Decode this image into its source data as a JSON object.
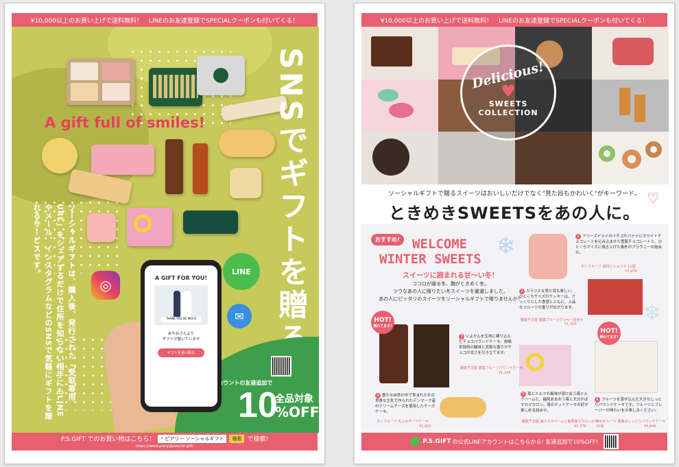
{
  "left": {
    "top_banner": "¥10,000以上のお買い上げで送料無料！　LINEのお友達登録でSPECIALクーポンも付いてくる！",
    "vertical_title": "SNSでギフトを贈ろう",
    "tagline": "A gift full of smiles!",
    "body_text": "ソーシャルギフトは、購入後、発行された「受取専用URL」をシェアするだけで住所を知らない相手にもLINEやメール、インスタグラムなどのSNSで気軽にギフトを贈れるサービスです。",
    "line_label": "LINE",
    "phone": {
      "header": "A GIFT FOR YOU!",
      "card_text": "THANK YOU SO MUCH",
      "message": "あやみさんより\nギフトが届いています",
      "button": "ギフトを受け取る"
    },
    "coupon": {
      "caption": "公式LINEアカウントの友達追加で",
      "big": "10",
      "label1": "全品対象",
      "label2": "%OFF"
    },
    "footer": {
      "prefix": "P.S.GIFT でのお買い物はこちら！",
      "search_text": "ピアリー ソーシャルギフト",
      "search_button": "検索",
      "suffix": "で検索!",
      "url": "https://www.piary.jp/social-gift/"
    }
  },
  "right": {
    "top_banner": "¥10,000以上のお買い上げで送料無料！　LINEのお友達登録でSPECIALクーポンも付いてくる！",
    "badge": {
      "script": "Delicious!",
      "line1": "SWEETS",
      "line2": "COLLECTION"
    },
    "subheadline": "ソーシャルギフトで贈るスイーツはおいしいだけでなく\"見た目もかわいく\"がキーワード。",
    "headline": "ときめきSWEETSをあの人に。",
    "recommend": "おすすめ!",
    "welcome1": "WELCOME",
    "welcome2": "WINTER SWEETS",
    "sub_welcome": "スイーツに囲まれる甘〜い冬！",
    "intro": "ココロが躍る冬、胸がときめく冬。\nツウなあの人に贈りたい冬スイーツを厳選しました。\nあの人にピッタリのスイーツをソーシャルギフトで贈りませんか？",
    "hot": "HOT!",
    "hot_sub": "売れてます!",
    "items": [
      {
        "num": "1",
        "text": "フリーズドライのイチゴやバナナにホワイトチョコレートを沁み込ませた雪面チョコレートと、ひとくちサイズに焼き上げた素朴のブラウニーの詰合せ。",
        "name": "ホシフルーツ 素材とショコラ 11個",
        "price": "¥3,978"
      },
      {
        "num": "2",
        "text": "カラフルな見た目も楽しい、ひとくちサイズのクッキーは、さっくりとした食感とともに、上品なフルーツの香りが広がります。",
        "name": "銀座千疋屋 銀座フルーツクッキー詰合せ",
        "price": "¥1,350"
      },
      {
        "num": "3",
        "text": "いよかんを生地に練り込んだチョコパウンドケーキ。柑橘系独特の酸味と芳醇な香りがチョコの甘さを引き立てます。",
        "name": "銀座千疋屋 銀座フルーツパウンドケーキ",
        "price": "¥1,296"
      },
      {
        "num": "4",
        "text": "豊かな自然の中で育まれた牛の良質な生乳で作られたデンマーク産のクリームチーズを使用したチーズケーキ。",
        "name": "ホシフルーツ 丸ふわチーズケーキ",
        "price": "¥1,420"
      },
      {
        "num": "5",
        "text": "苺とミルクの風味が溶け合う苺ミルクバームと、福岡あまおう苺と大分かぼすのマカロン。苺のホットケーキの好が楽しめる詰合せ。",
        "name": "銀座千疋屋 苺ミルクバームと苺果実マカロンのセット",
        "price": "¥2,376"
      },
      {
        "num": "6",
        "text": "フルーツを混ぜ込んだ大きなしっとりパウンドケーキです。フルーツとフレーバーの味わいをお楽しみください。",
        "name": "ホシフルーツ 果実のしっとりパウンドケーキ 10個",
        "price": "¥4,946"
      }
    ],
    "footer": {
      "brand": "P.S.GIFT",
      "text": "の公式LINEアカウントはこちらから! 友達追加で10%OFF!"
    }
  },
  "colors": {
    "pink": "#e8606f",
    "olive": "#c7c95a",
    "green": "#3e9e4b"
  }
}
